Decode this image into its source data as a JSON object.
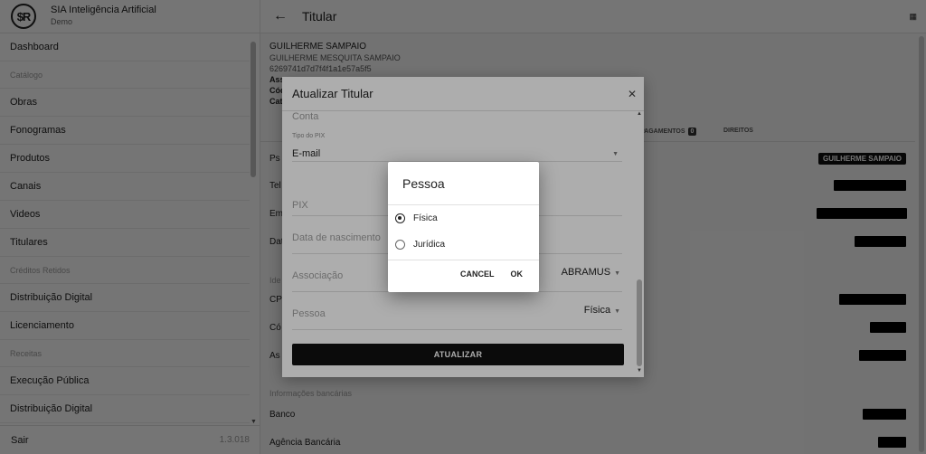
{
  "app": {
    "logo_text": "$R",
    "title": "SIA Inteligência Artificial",
    "subtitle": "Demo"
  },
  "sidebar": {
    "items": [
      {
        "type": "item",
        "label": "Dashboard"
      },
      {
        "type": "section",
        "label": "Catálogo"
      },
      {
        "type": "item",
        "label": "Obras"
      },
      {
        "type": "item",
        "label": "Fonogramas"
      },
      {
        "type": "item",
        "label": "Produtos"
      },
      {
        "type": "item",
        "label": "Canais"
      },
      {
        "type": "item",
        "label": "Videos"
      },
      {
        "type": "item",
        "label": "Titulares"
      },
      {
        "type": "section",
        "label": "Créditos Retidos"
      },
      {
        "type": "item",
        "label": "Distribuição Digital"
      },
      {
        "type": "item",
        "label": "Licenciamento"
      },
      {
        "type": "section",
        "label": "Receitas"
      },
      {
        "type": "item",
        "label": "Execução Pública"
      },
      {
        "type": "item",
        "label": "Distribuição Digital"
      }
    ],
    "footer_label": "Sair",
    "version": "1.3.018"
  },
  "topbar": {
    "back_icon": "arrow-left-icon",
    "title": "Titular",
    "apps_icon": "grid-icon"
  },
  "header": {
    "name": "GUILHERME SAMPAIO",
    "full_name": "GUILHERME MESQUITA SAMPAIO",
    "id": "6269741d7d7f4f1a1e57a5f5",
    "line1": "Ass",
    "line2": "Cód",
    "line3": "Cat"
  },
  "tabs": [
    {
      "label": "PAGAMENTOS",
      "badge": "0"
    },
    {
      "label": "DIREITOS"
    }
  ],
  "detail_rows": {
    "r1": "Ps",
    "r2": "Tel",
    "r3": "Em",
    "r4": "Dat",
    "section_ident": "Ide",
    "r5": "CP",
    "r6": "Có",
    "r7": "As",
    "section_bank": "Informações bancárias",
    "r8": "Banco",
    "r9": "Agência Bancária",
    "name_chip": "GUILHERME SAMPAIO"
  },
  "update_dialog": {
    "title": "Atualizar Titular",
    "close_icon": "close-icon",
    "fields": {
      "conta_label": "Conta",
      "tipo_pix_label": "Tipo do PIX",
      "tipo_pix_value": "E-mail",
      "pix_placeholder": "PIX",
      "nascimento_placeholder": "Data de nascimento",
      "associacao_label": "Associação",
      "associacao_value": "ABRAMUS",
      "pessoa_label": "Pessoa",
      "pessoa_value": "Física"
    },
    "submit_label": "ATUALIZAR"
  },
  "pessoa_dialog": {
    "title": "Pessoa",
    "options": [
      {
        "label": "Física",
        "selected": true
      },
      {
        "label": "Jurídica",
        "selected": false
      }
    ],
    "cancel_label": "CANCEL",
    "ok_label": "OK"
  }
}
